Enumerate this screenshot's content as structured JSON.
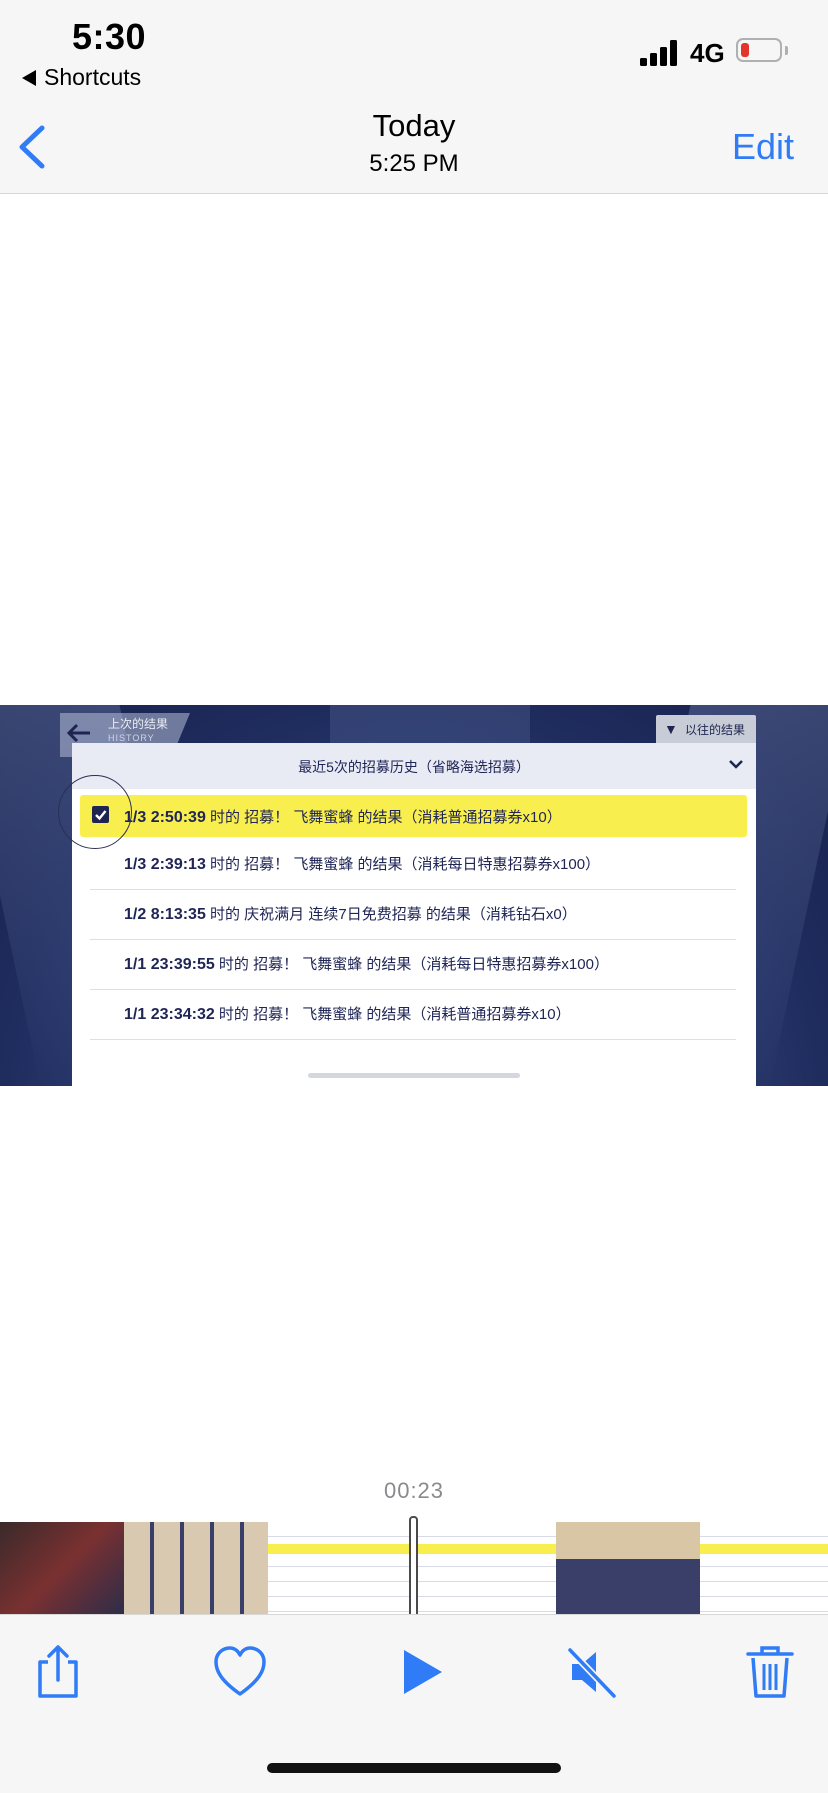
{
  "status_bar": {
    "time": "5:30",
    "back_app": "Shortcuts",
    "network": "4G",
    "battery_color": "#e2362c"
  },
  "nav": {
    "back_icon": "chevron-left-icon",
    "title": "Today",
    "subtitle": "5:25 PM",
    "edit_label": "Edit",
    "accent": "#2f7cf6"
  },
  "video_frame": {
    "history_tab": {
      "title": "上次的结果",
      "subtitle": "HISTORY"
    },
    "previous_results_button": "以往的结果",
    "panel_title": "最近5次的招募历史（省略海选招募）",
    "rows": [
      {
        "time": "1/3 2:50:39",
        "text": "时的 招募！ 飞舞蜜蜂 的结果（消耗普通招募券x10）",
        "selected": true
      },
      {
        "time": "1/3 2:39:13",
        "text": "时的 招募！ 飞舞蜜蜂 的结果（消耗每日特惠招募券x100）",
        "selected": false
      },
      {
        "time": "1/2 8:13:35",
        "text": "时的 庆祝满月 连续7日免费招募 的结果（消耗钻石x0）",
        "selected": false
      },
      {
        "time": "1/1 23:39:55",
        "text": "时的 招募！ 飞舞蜜蜂 的结果（消耗每日特惠招募券x100）",
        "selected": false
      },
      {
        "time": "1/1 23:34:32",
        "text": "时的 招募！ 飞舞蜜蜂 的结果（消耗普通招募券x10）",
        "selected": false
      }
    ],
    "highlight_color": "#f8ef4f"
  },
  "playback": {
    "elapsed": "00:23"
  },
  "toolbar": {
    "icons": [
      "share-icon",
      "heart-icon",
      "play-icon",
      "mute-icon",
      "trash-icon"
    ]
  }
}
